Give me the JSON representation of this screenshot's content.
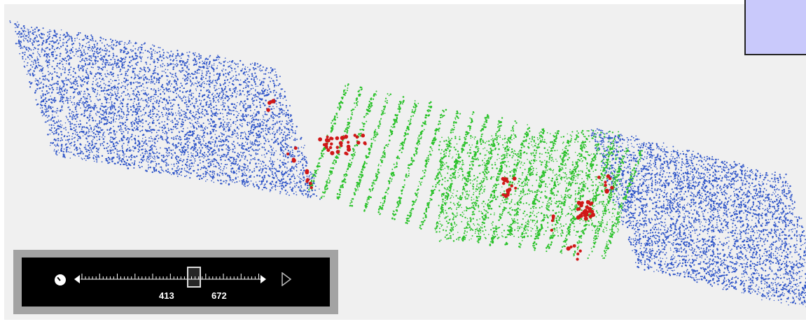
{
  "corner_panel": {
    "color": "#c9c9fb"
  },
  "scene": {
    "background": "#f0f0f0",
    "colors": {
      "solvent": "#2f55c8",
      "protein": "#2bc22b",
      "ligand": "#d01818"
    }
  },
  "timeline": {
    "icons": {
      "clock": "clock-icon",
      "left": "arrow-left-icon",
      "right": "arrow-right-icon",
      "play": "play-icon"
    },
    "range_start": "413",
    "range_end": "672"
  }
}
